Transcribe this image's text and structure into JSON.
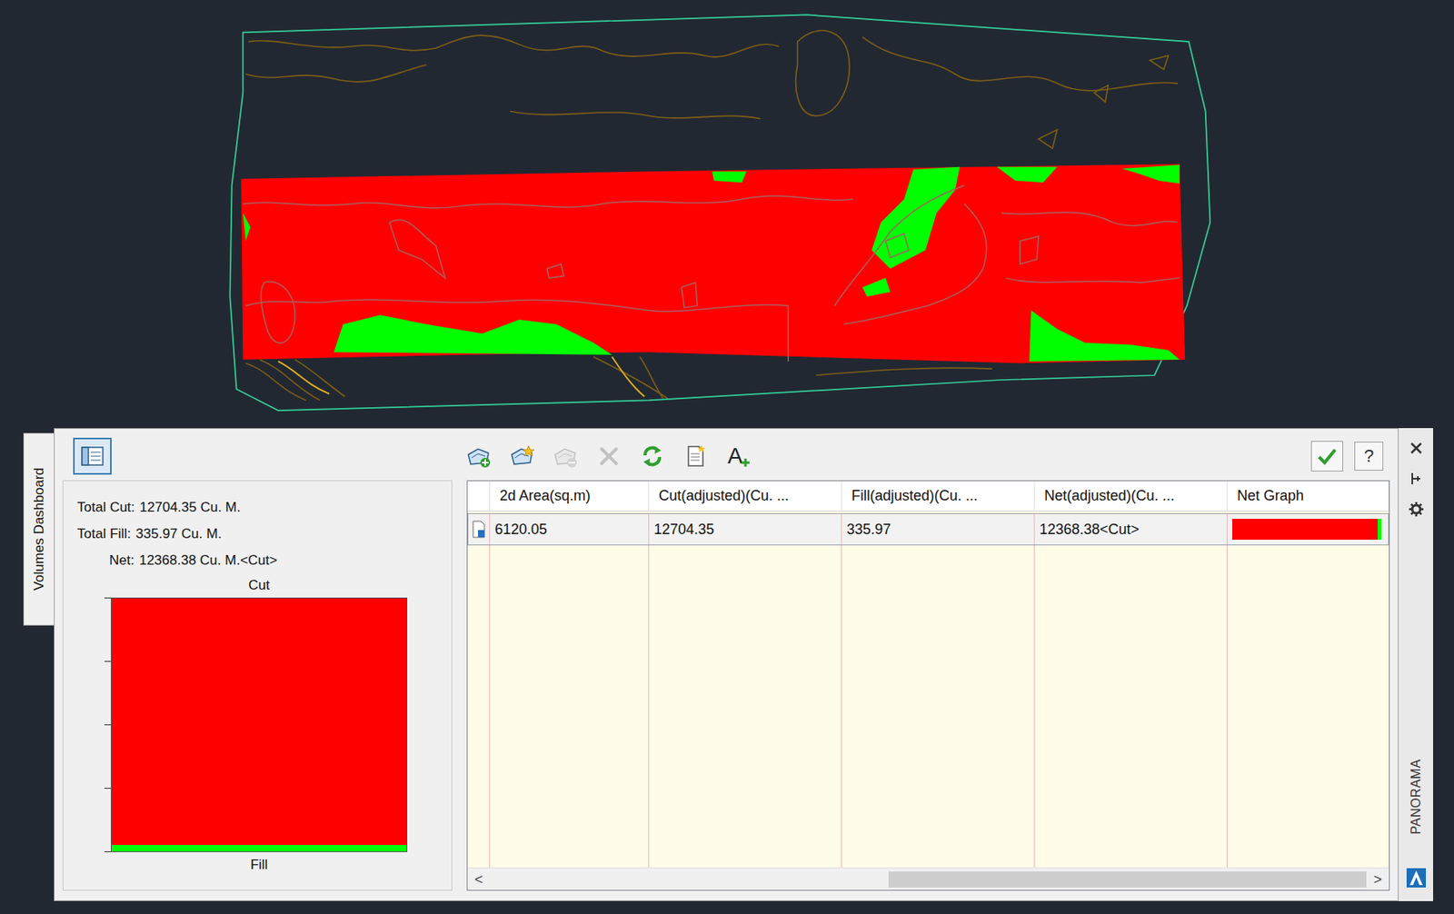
{
  "dashboard_tab": {
    "label": "Volumes Dashboard",
    "selected": true
  },
  "toolbar": {
    "panel_toggle_selected": true,
    "buttons": [
      {
        "kind": "add-entry",
        "disabled": false
      },
      {
        "kind": "new-surface",
        "disabled": false
      },
      {
        "kind": "remove-entry",
        "disabled": true
      },
      {
        "kind": "delete",
        "disabled": true
      },
      {
        "kind": "refresh",
        "disabled": false
      },
      {
        "kind": "report",
        "disabled": false
      },
      {
        "kind": "add-labels",
        "glyph": "A",
        "disabled": false
      }
    ],
    "help": "?"
  },
  "summary": {
    "lines": [
      {
        "label": "Total Cut:",
        "value": "12704.35 Cu. M."
      },
      {
        "label": "Total Fill:",
        "value": "335.97 Cu. M."
      },
      {
        "label": "Net:",
        "value": "12368.38 Cu. M.<Cut>"
      }
    ],
    "chart": {
      "title": "Cut",
      "axis_label": "Fill",
      "series": [
        {
          "value": 12704.35,
          "color": "#ff0000"
        },
        {
          "value": 335.97,
          "color": "#00ff00"
        }
      ]
    }
  },
  "table": {
    "columns": [
      "2d Area(sq.m)",
      "Cut(adjusted)(Cu. ...",
      "Fill(adjusted)(Cu. ...",
      "Net(adjusted)(Cu. ...",
      "Net Graph"
    ],
    "rows": [
      {
        "selected": true,
        "cells": [
          "6120.05",
          "12704.35",
          "335.97",
          "12368.38<Cut>"
        ],
        "net_graph_level": 0.974
      }
    ]
  },
  "scrollbar": {
    "left": "<",
    "right": ">",
    "thumb_start": 0.455,
    "thumb_size": 0.545
  },
  "side_strip": {
    "label": "PANORAMA"
  }
}
